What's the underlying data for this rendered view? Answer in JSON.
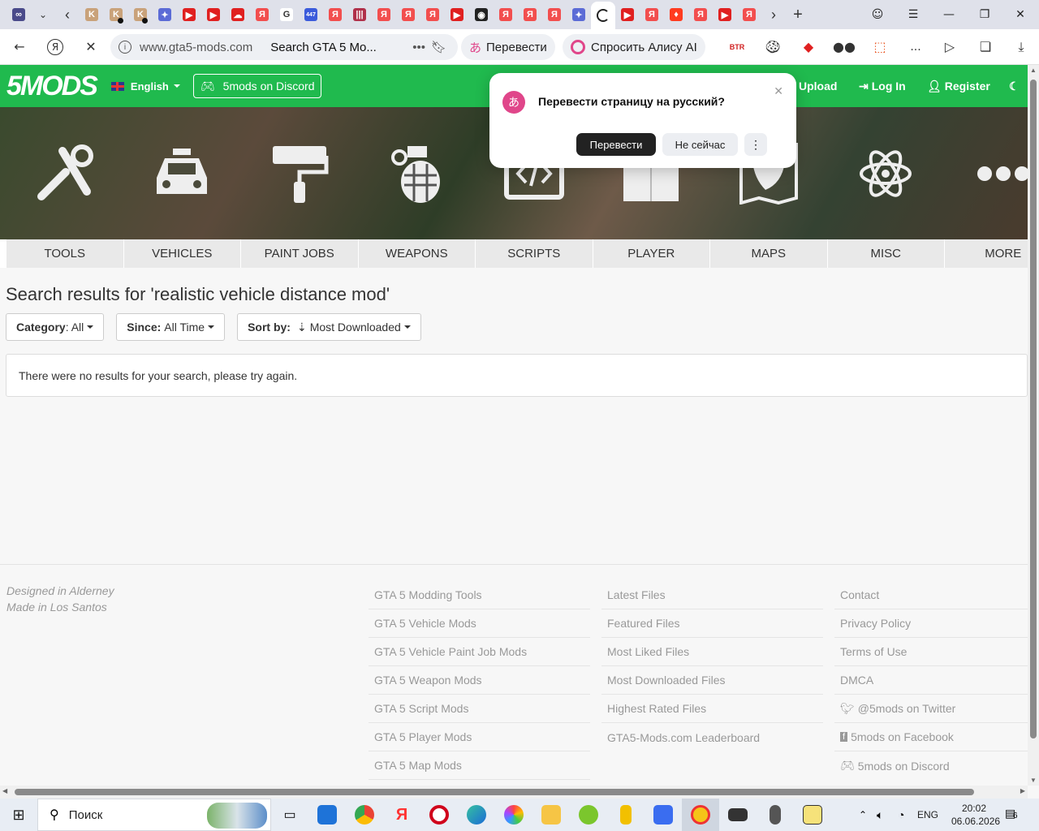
{
  "browser": {
    "url": "www.gta5-mods.com",
    "page_title": "Search GTA 5 Mo...",
    "translate_label": "Перевести",
    "ask_alice_label": "Спросить Алису AI",
    "more_label": "...",
    "ext_btr": "BTR",
    "tab_badge": "447"
  },
  "site": {
    "logo": "5MODS",
    "language": "English",
    "discord_button": "5mods on Discord",
    "upload": "Upload",
    "login": "Log In",
    "register": "Register",
    "categories": [
      "TOOLS",
      "VEHICLES",
      "PAINT JOBS",
      "WEAPONS",
      "SCRIPTS",
      "PLAYER",
      "MAPS",
      "MISC",
      "MORE"
    ],
    "search_title": "Search results for 'realistic vehicle distance mod'",
    "filters": {
      "category_label": "Category",
      "category_value": ": All",
      "since_label": "Since:",
      "since_value": "All Time",
      "sort_label": "Sort by:",
      "sort_value": "Most Downloaded"
    },
    "no_results": "There were no results for your search, please try again."
  },
  "footer": {
    "tagline1": "Designed in Alderney",
    "tagline2": "Made in Los Santos",
    "col1": [
      "GTA 5 Modding Tools",
      "GTA 5 Vehicle Mods",
      "GTA 5 Vehicle Paint Job Mods",
      "GTA 5 Weapon Mods",
      "GTA 5 Script Mods",
      "GTA 5 Player Mods",
      "GTA 5 Map Mods"
    ],
    "col2": [
      "Latest Files",
      "Featured Files",
      "Most Liked Files",
      "Most Downloaded Files",
      "Highest Rated Files",
      "GTA5-Mods.com Leaderboard"
    ],
    "col3": [
      "Contact",
      "Privacy Policy",
      "Terms of Use",
      "DMCA",
      "@5mods on Twitter",
      "5mods on Facebook",
      "5mods on Discord"
    ]
  },
  "translate_popup": {
    "question": "Перевести страницу на русский?",
    "translate_button": "Перевести",
    "not_now_button": "Не сейчас"
  },
  "taskbar": {
    "search_label": "Поиск",
    "language": "ENG",
    "time": "20:02",
    "date": "06.06.2026",
    "notifications": "6"
  },
  "colors": {
    "site_green": "#20ba4e",
    "tab_strip": "#dfe1ea"
  }
}
